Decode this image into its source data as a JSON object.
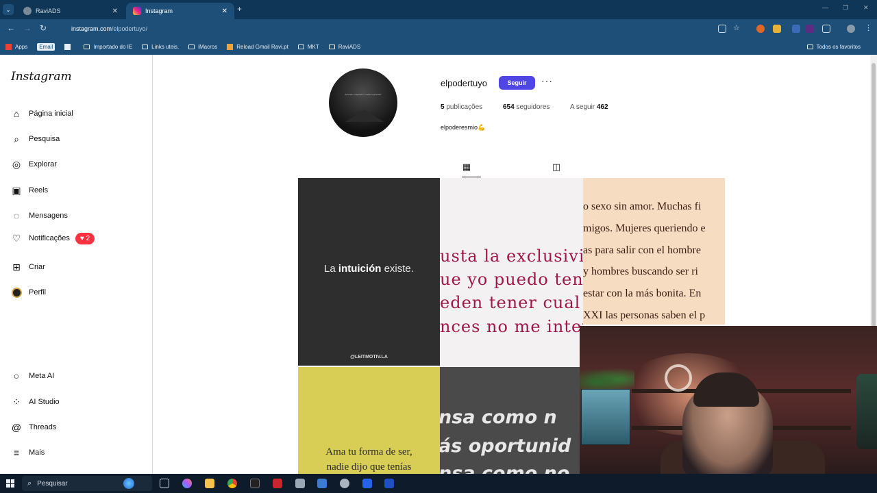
{
  "browser": {
    "tabs": [
      {
        "title": "RaviADS",
        "active": false,
        "close": "✕"
      },
      {
        "title": "Instagram",
        "active": true,
        "close": "✕"
      }
    ],
    "new_tab": "+",
    "url_host": "instagram.com",
    "url_path": "/elpodertuyo/",
    "bookmarks": [
      {
        "label": "Apps",
        "icon": "apps-grid-icon"
      },
      {
        "label": "Email",
        "icon": "email-icon"
      },
      {
        "label": "",
        "icon": "grid-icon"
      },
      {
        "label": "Importado do IE",
        "icon": "folder-icon"
      },
      {
        "label": "Links uteis.",
        "icon": "folder-icon"
      },
      {
        "label": "iMacros",
        "icon": "folder-icon"
      },
      {
        "label": "Reload Gmail Ravi.pt",
        "icon": "reload-icon"
      },
      {
        "label": "MKT",
        "icon": "folder-icon"
      },
      {
        "label": "RaviADS",
        "icon": "folder-icon"
      }
    ],
    "bookmarks_right": "Todos os favoritos"
  },
  "sidebar": {
    "logo": "Instagram",
    "items": [
      {
        "label": "Página inicial",
        "icon": "home-icon"
      },
      {
        "label": "Pesquisa",
        "icon": "search-icon"
      },
      {
        "label": "Explorar",
        "icon": "compass-icon"
      },
      {
        "label": "Reels",
        "icon": "reels-icon"
      },
      {
        "label": "Mensagens",
        "icon": "messenger-icon"
      },
      {
        "label": "Notificações",
        "icon": "heart-icon",
        "badge": "2"
      },
      {
        "label": "Criar",
        "icon": "plus-square-icon"
      },
      {
        "label": "Perfil",
        "icon": "avatar-icon"
      }
    ],
    "bottom_items": [
      {
        "label": "Meta AI",
        "icon": "meta-ai-icon"
      },
      {
        "label": "AI Studio",
        "icon": "ai-studio-icon"
      },
      {
        "label": "Threads",
        "icon": "threads-icon"
      },
      {
        "label": "Mais",
        "icon": "menu-icon"
      }
    ]
  },
  "profile": {
    "username": "elpodertuyo",
    "follow_label": "Seguir",
    "more": "···",
    "posts_count": "5",
    "posts_label": "publicações",
    "followers_count": "654",
    "followers_label": "seguidores",
    "following_label": "A seguir",
    "following_count": "462",
    "bio": "elpoderesmio💪",
    "avatar_text": "Aprende, imagínalo y vuelve a aprender"
  },
  "posts": {
    "p1": {
      "prefix": "La ",
      "bold": "intuición",
      "suffix": " existe.",
      "signature": "@LEITMOTIV.LA"
    },
    "p2": {
      "lines": [
        "usta la exclusivi",
        "ue yo puedo ten",
        "eden tener cual",
        "nces no me inter"
      ]
    },
    "p3": {
      "lines": [
        "o sexo sin amor. Muchas fi",
        "migos. Mujeres queriendo e",
        "as para salir con el hombre",
        "y hombres buscando ser ri",
        "estar con la más bonita. En",
        "XXI las personas saben el p"
      ]
    },
    "p4": {
      "lines": [
        "Ama tu forma de ser,",
        "nadie dijo que tenías"
      ]
    },
    "p5": {
      "lines": [
        "nsa como n",
        "ás oportunid",
        "nsa como no"
      ]
    }
  },
  "taskbar": {
    "search_placeholder": "Pesquisar"
  },
  "colors": {
    "chrome_dark": "#0f3657",
    "chrome": "#1d4f79",
    "follow_button": "#4f46e5",
    "notification_badge": "#ff3040"
  }
}
